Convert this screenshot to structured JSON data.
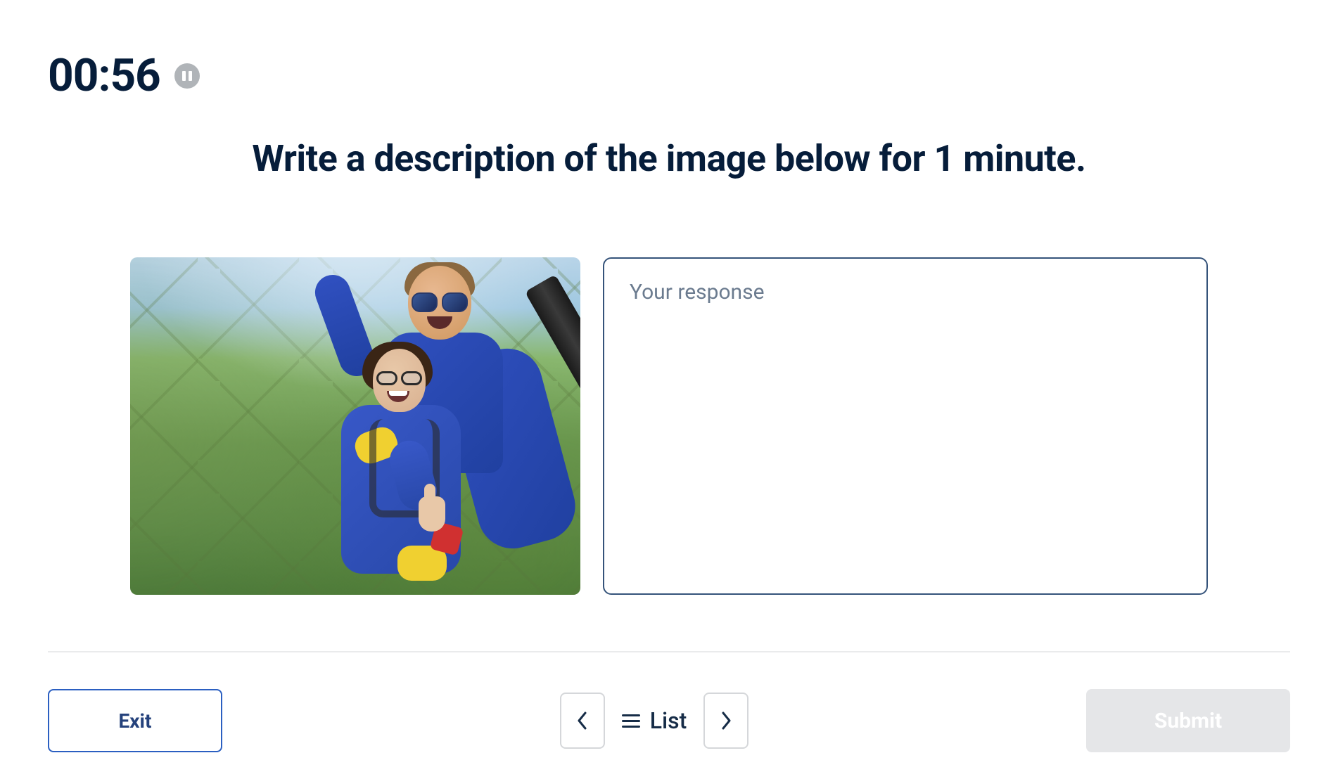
{
  "timer": {
    "display": "00:56"
  },
  "prompt": {
    "text": "Write a description of the image below for 1 minute."
  },
  "response": {
    "placeholder": "Your response",
    "value": ""
  },
  "footer": {
    "exit_label": "Exit",
    "list_label": "List",
    "submit_label": "Submit"
  },
  "image": {
    "description": "tandem-skydiving-photo"
  }
}
